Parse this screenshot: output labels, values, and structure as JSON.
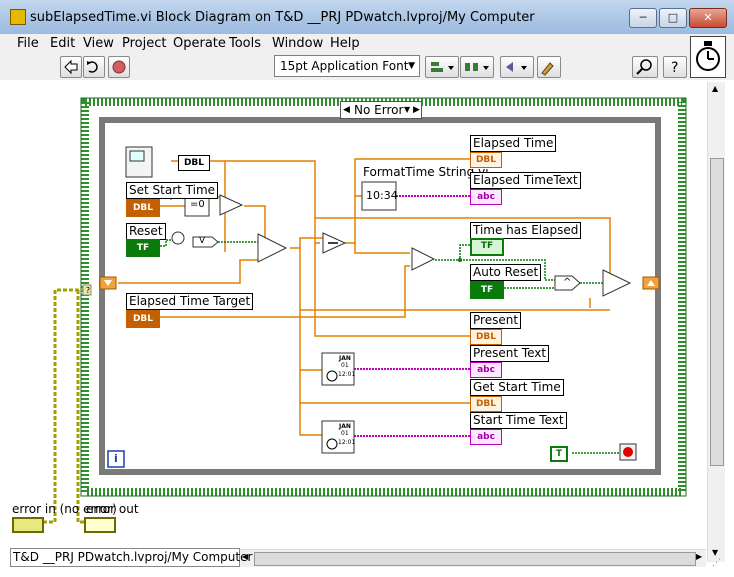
{
  "window": {
    "title": "subElapsedTime.vi Block Diagram on T&D __PRJ PDwatch.lvproj/My Computer",
    "minimize_label": "─",
    "maximize_label": "□",
    "close_label": "✕"
  },
  "menu": [
    "File",
    "Edit",
    "View",
    "Project",
    "Operate",
    "Tools",
    "Window",
    "Help"
  ],
  "toolbar": {
    "font_selector": "15pt Application Font"
  },
  "case_structure": {
    "selector_value": "No Error",
    "loop_iteration_label": "i"
  },
  "controls": {
    "set_start_time": "Set Start Time",
    "reset": "Reset",
    "elapsed_time_target": "Elapsed Time Target",
    "auto_reset": "Auto Reset",
    "error_in": "error in (no error)",
    "error_out": "error out"
  },
  "indicators": {
    "elapsed_time": "Elapsed Time",
    "elapsed_time_text": "Elapsed TimeText",
    "time_has_elapsed": "Time has Elapsed",
    "present": "Present",
    "present_text": "Present Text",
    "get_start_time": "Get Start Time",
    "start_time_text": "Start Time Text"
  },
  "nodes": {
    "format_time_string_vi": "FormatTime String.vi",
    "format_time_icon_text": "10:34",
    "dbl_tag": "DBL",
    "tf_tag": "TF",
    "abc_tag": "abc",
    "const_true": "T",
    "eq_zero": "=0",
    "and_label": "^",
    "not_label": "V",
    "datetime_icon_month": "JAN",
    "datetime_icon_day": "01",
    "datetime_icon_time": "12:01"
  },
  "status": {
    "context": "T&D __PRJ PDwatch.lvproj/My Computer"
  },
  "colors": {
    "titlebar": "#a9c4e4",
    "dbl_wire": "#e08000",
    "string_wire": "#c000c0",
    "boolean_wire": "#0a7a0a",
    "error_wire": "#a0a000",
    "case_border": "#2f8f2f"
  }
}
